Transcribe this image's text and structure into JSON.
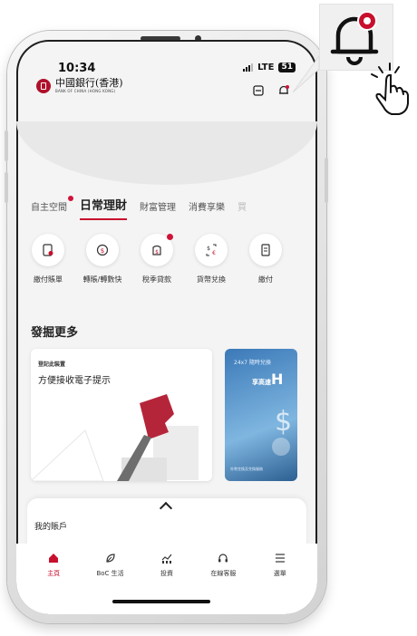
{
  "status_bar": {
    "time": "10:34",
    "network": "LTE",
    "battery": "51"
  },
  "header": {
    "bank_name_cn": "中國銀行(香港)",
    "bank_name_en": "BANK OF CHINA (HONG KONG)",
    "icons": [
      "inbox-icon",
      "bell-icon"
    ]
  },
  "tabs": [
    {
      "label": "自主空間",
      "badge": true
    },
    {
      "label": "日常理財",
      "active": true
    },
    {
      "label": "財富管理"
    },
    {
      "label": "消費享樂"
    },
    {
      "label": "買"
    }
  ],
  "quick_actions": [
    {
      "label": "繳付賬單",
      "icon": "bill-icon",
      "badge": false
    },
    {
      "label": "轉賬/轉數快",
      "icon": "transfer-icon",
      "badge": false
    },
    {
      "label": "稅季貸款",
      "icon": "loan-icon",
      "badge": true
    },
    {
      "label": "貨幣兌換",
      "icon": "currency-exchange-icon",
      "badge": false
    },
    {
      "label": "繳付",
      "icon": "payment-icon",
      "badge": false
    }
  ],
  "discover": {
    "title": "發掘更多",
    "card1": {
      "subtitle": "登記此裝置",
      "text": "方便接收電子提示"
    },
    "card2": {
      "tag": "24x7 隨時兌換",
      "headline": "享高速",
      "headline_big": "H",
      "footnote": "外幣兌換及兌換服務"
    }
  },
  "accounts": {
    "title": "我的賬戶"
  },
  "bottom_nav": [
    {
      "label": "主頁",
      "icon": "home-icon",
      "active": true
    },
    {
      "label": "BoC 生活",
      "icon": "leaf-icon"
    },
    {
      "label": "投資",
      "icon": "investment-icon"
    },
    {
      "label": "在線客服",
      "icon": "headset-icon"
    },
    {
      "label": "選單",
      "icon": "menu-icon"
    }
  ],
  "colors": {
    "brand_red": "#c8102e",
    "badge_red": "#d0123b"
  }
}
